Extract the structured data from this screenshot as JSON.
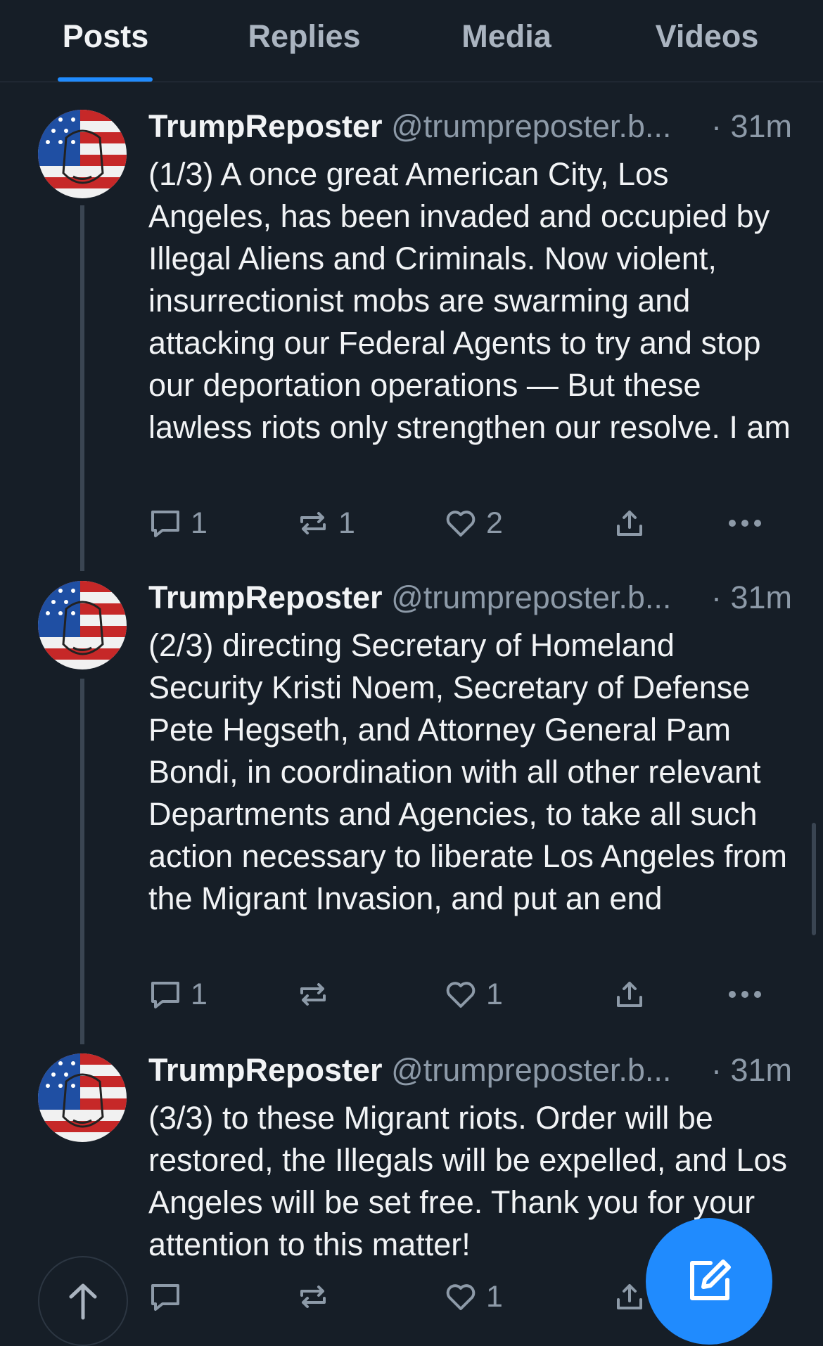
{
  "tabs": [
    {
      "label": "Posts"
    },
    {
      "label": "Replies"
    },
    {
      "label": "Media"
    },
    {
      "label": "Videos"
    }
  ],
  "posts": [
    {
      "display_name": "TrumpReposter",
      "handle": "@trumpreposter.b...",
      "time": "· 31m",
      "text": "(1/3) A once great American City, Los Angeles, has been invaded and occupied by Illegal Aliens and Criminals. Now violent, insurrectionist mobs are swarming and attacking our Federal Agents to try and stop our deportation operations — But these lawless riots only strengthen our resolve. I am",
      "replies": "1",
      "reposts": "1",
      "likes": "2"
    },
    {
      "display_name": "TrumpReposter",
      "handle": "@trumpreposter.b...",
      "time": "· 31m",
      "text": "(2/3) directing Secretary of Homeland Security Kristi Noem, Secretary of Defense Pete Hegseth, and Attorney General Pam Bondi, in coordination with all other relevant Departments and Agencies, to take all such action necessary to liberate Los Angeles from the Migrant Invasion, and put an end",
      "replies": "1",
      "reposts": "",
      "likes": "1"
    },
    {
      "display_name": "TrumpReposter",
      "handle": "@trumpreposter.b...",
      "time": "· 31m",
      "text": "(3/3) to these Migrant riots. Order will be restored, the Illegals will be expelled, and Los Angeles will be set free. Thank you for your attention to this matter!",
      "replies": "",
      "reposts": "",
      "likes": "1"
    }
  ],
  "icons": {
    "reply": "speech-bubble-icon",
    "repost": "repost-arrows-icon",
    "like": "heart-icon",
    "share": "share-icon",
    "more": "ellipsis-icon",
    "scroll_top": "arrow-up-icon",
    "compose": "compose-icon"
  },
  "colors": {
    "background": "#161e27",
    "accent": "#208bfe",
    "muted_text": "#8d9aa8",
    "text": "#f1f3f5"
  }
}
